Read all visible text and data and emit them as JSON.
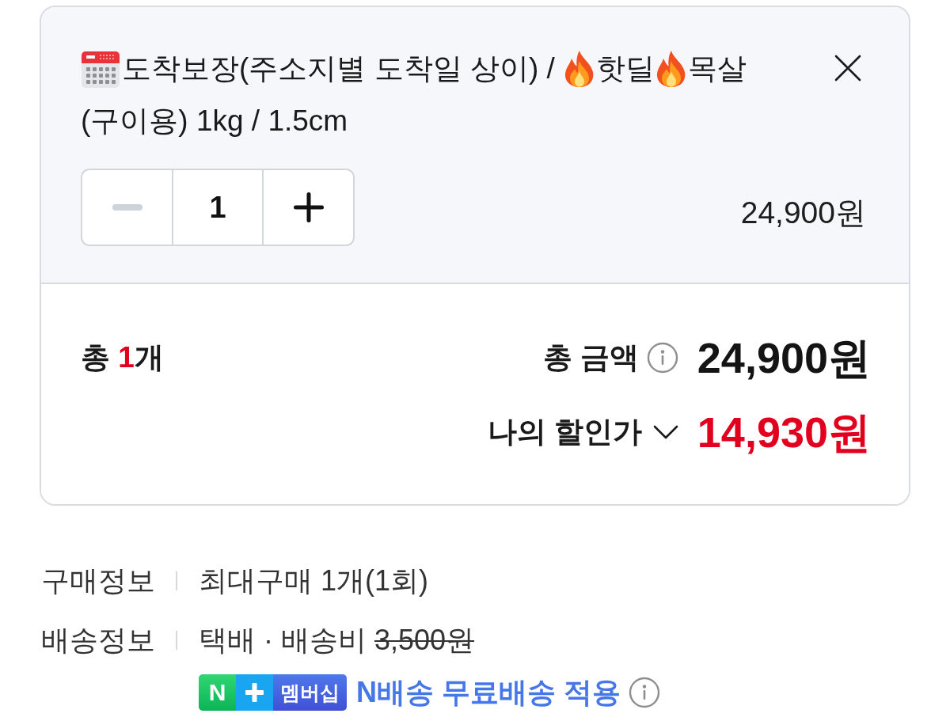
{
  "cart_item": {
    "title": [
      {
        "kind": "calendar"
      },
      {
        "kind": "text",
        "text": "도착보장(주소지별 도착일 상이) / "
      },
      {
        "kind": "fire"
      },
      {
        "kind": "text",
        "text": "핫딜"
      },
      {
        "kind": "fire"
      },
      {
        "kind": "text",
        "text": "목살"
      },
      {
        "kind": "text",
        "text": "(구이용) 1kg / 1.5cm"
      }
    ],
    "quantity": {
      "value": "1",
      "decrease_disabled": true
    },
    "price": "24,900원"
  },
  "summary": {
    "count_prefix": "총 ",
    "count": "1",
    "count_suffix": "개",
    "total_label": "총 금액",
    "total": "24,900원",
    "discount_label": "나의 할인가",
    "discount_expanded": false,
    "discount_price": "14,930원"
  },
  "info_rows": [
    {
      "label": "구매정보",
      "text": "최대구매 1개(1회)"
    },
    {
      "label": "배송정보",
      "text": "택배 · 배송비",
      "fee": {
        "text": "3,500원",
        "struck": true
      },
      "membership": {
        "badge_mark": "N",
        "badge_label": "멤버십",
        "text": "N배송 무료배송 적용"
      }
    }
  ]
}
